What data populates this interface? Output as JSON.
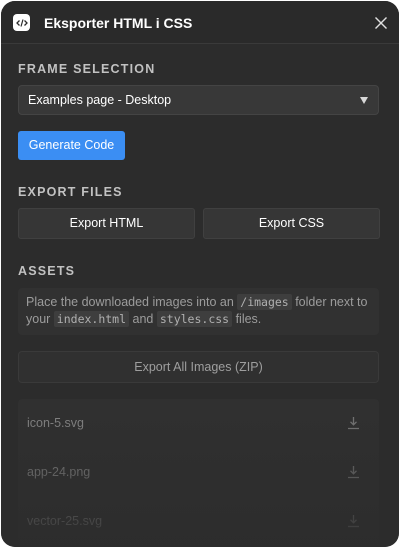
{
  "header": {
    "title": "Eksporter HTML i CSS",
    "icon": "code-icon",
    "close_icon": "close-icon"
  },
  "frame_selection": {
    "label": "FRAME SELECTION",
    "selected": "Examples page - Desktop",
    "generate_label": "Generate Code"
  },
  "export_files": {
    "label": "EXPORT FILES",
    "html_label": "Export HTML",
    "css_label": "Export CSS"
  },
  "assets": {
    "label": "ASSETS",
    "info": {
      "part1": "Place the downloaded images into an ",
      "code1": "/images",
      "part2": " folder next to your ",
      "code2": "index.html",
      "part3": " and ",
      "code3": "styles.css",
      "part4": " files."
    },
    "zip_label": "Export All Images (ZIP)",
    "files": [
      {
        "name": "icon-5.svg"
      },
      {
        "name": "app-24.png"
      },
      {
        "name": "vector-25.svg"
      }
    ]
  },
  "colors": {
    "accent": "#3b8ef3",
    "background": "#2c2c2c"
  }
}
